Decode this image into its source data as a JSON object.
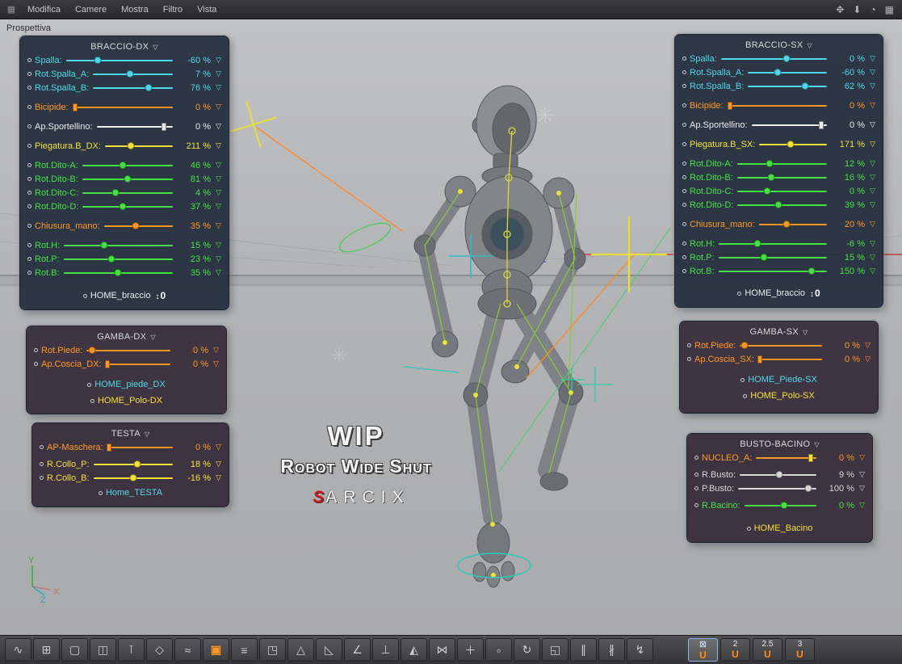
{
  "colors": {
    "cyan": "#4fd8ea",
    "orange": "#ff9822",
    "yellow": "#f2e03c",
    "green": "#46e046",
    "white": "#ececec",
    "gray": "#d8d8d8"
  },
  "menubar": {
    "items": [
      "Modifica",
      "Camere",
      "Mostra",
      "Filtro",
      "Vista"
    ],
    "right_icons": [
      {
        "name": "pan-icon",
        "glyph": "✥"
      },
      {
        "name": "down-arrow-icon",
        "glyph": "⬇"
      },
      {
        "name": "clock-icon",
        "glyph": "◔"
      },
      {
        "name": "grid-icon",
        "glyph": "▦"
      }
    ]
  },
  "viewport": {
    "view_label": "Prospettiva",
    "watermark_line1": "WIP",
    "watermark_line2": "Robot Wide Shut",
    "logo_s": "S",
    "logo_text": "ARCIX",
    "axis_x": "X",
    "axis_y": "Y",
    "axis_z": "Z"
  },
  "panels": [
    {
      "id": "braccio-dx",
      "title": "BRACCIO-DX",
      "theme": "blue",
      "rows": [
        {
          "type": "slider",
          "label": "Spalla:",
          "value": "-60 %",
          "color": "cyan",
          "pos": 0.3
        },
        {
          "type": "slider",
          "label": "Rot.Spalla_A:",
          "value": "7 %",
          "color": "cyan",
          "pos": 0.46
        },
        {
          "type": "slider",
          "label": "Rot.Spalla_B:",
          "value": "76 %",
          "color": "cyan",
          "pos": 0.7
        },
        {
          "type": "gap"
        },
        {
          "type": "slider",
          "label": "Bicipide:",
          "value": "0 %",
          "color": "orange",
          "pos": 0.03,
          "shape": "square"
        },
        {
          "type": "gap"
        },
        {
          "type": "slider",
          "label": "Ap.Sportellino:",
          "value": "0 %",
          "color": "white",
          "pos": 0.88,
          "shape": "square"
        },
        {
          "type": "gap"
        },
        {
          "type": "slider",
          "label": "Piegatura.B_DX:",
          "value": "211 %",
          "color": "yellow",
          "pos": 0.38
        },
        {
          "type": "gap"
        },
        {
          "type": "slider",
          "label": "Rot.Dito-A:",
          "value": "46 %",
          "color": "green",
          "pos": 0.45
        },
        {
          "type": "slider",
          "label": "Rot.Dito-B:",
          "value": "81 %",
          "color": "green",
          "pos": 0.5
        },
        {
          "type": "slider",
          "label": "Rot.Dito-C:",
          "value": "4 %",
          "color": "green",
          "pos": 0.36
        },
        {
          "type": "slider",
          "label": "Rot.Dito-D:",
          "value": "37 %",
          "color": "green",
          "pos": 0.44
        },
        {
          "type": "gap"
        },
        {
          "type": "slider",
          "label": "Chiusura_mano:",
          "value": "35 %",
          "color": "orange",
          "pos": 0.46
        },
        {
          "type": "gap"
        },
        {
          "type": "slider",
          "label": "Rot.H:",
          "value": "15 %",
          "color": "green",
          "pos": 0.37
        },
        {
          "type": "slider",
          "label": "Rot.P:",
          "value": "23 %",
          "color": "green",
          "pos": 0.44
        },
        {
          "type": "slider",
          "label": "Rot.B:",
          "value": "35 %",
          "color": "green",
          "pos": 0.5
        },
        {
          "type": "home",
          "label": "HOME_braccio",
          "color": "white",
          "icon": "reset-zero"
        }
      ]
    },
    {
      "id": "braccio-sx",
      "title": "BRACCIO-SX",
      "theme": "blue",
      "rows": [
        {
          "type": "slider",
          "label": "Spalla:",
          "value": "0 %",
          "color": "cyan",
          "pos": 0.62
        },
        {
          "type": "slider",
          "label": "Rot.Spalla_A:",
          "value": "-60 %",
          "color": "cyan",
          "pos": 0.38
        },
        {
          "type": "slider",
          "label": "Rot.Spalla_B:",
          "value": "62 %",
          "color": "cyan",
          "pos": 0.72
        },
        {
          "type": "gap"
        },
        {
          "type": "slider",
          "label": "Bicipide:",
          "value": "0 %",
          "color": "orange",
          "pos": 0.03,
          "shape": "square"
        },
        {
          "type": "gap"
        },
        {
          "type": "slider",
          "label": "Ap.Sportellino:",
          "value": "0 %",
          "color": "white",
          "pos": 0.93,
          "shape": "square"
        },
        {
          "type": "gap"
        },
        {
          "type": "slider",
          "label": "Piegatura.B_SX:",
          "value": "171 %",
          "color": "yellow",
          "pos": 0.46
        },
        {
          "type": "gap"
        },
        {
          "type": "slider",
          "label": "Rot.Dito-A:",
          "value": "12 %",
          "color": "green",
          "pos": 0.36
        },
        {
          "type": "slider",
          "label": "Rot.Dito-B:",
          "value": "16 %",
          "color": "green",
          "pos": 0.38
        },
        {
          "type": "slider",
          "label": "Rot.Dito-C:",
          "value": "0 %",
          "color": "green",
          "pos": 0.33
        },
        {
          "type": "slider",
          "label": "Rot.Dito-D:",
          "value": "39 %",
          "color": "green",
          "pos": 0.46
        },
        {
          "type": "gap"
        },
        {
          "type": "slider",
          "label": "Chiusura_mano:",
          "value": "20 %",
          "color": "orange",
          "pos": 0.41
        },
        {
          "type": "gap"
        },
        {
          "type": "slider",
          "label": "Rot.H:",
          "value": "-6 %",
          "color": "green",
          "pos": 0.36
        },
        {
          "type": "slider",
          "label": "Rot.P:",
          "value": "15 %",
          "color": "green",
          "pos": 0.42
        },
        {
          "type": "slider",
          "label": "Rot.B:",
          "value": "150 %",
          "color": "green",
          "pos": 0.86
        },
        {
          "type": "home",
          "label": "HOME_braccio",
          "color": "white",
          "icon": "reset-zero"
        }
      ]
    },
    {
      "id": "gamba-dx",
      "title": "GAMBA-DX",
      "theme": "purple",
      "rows": [
        {
          "type": "slider",
          "label": "Rot.Piede:",
          "value": "0 %",
          "color": "orange",
          "pos": 0.06
        },
        {
          "type": "slider",
          "label": "Ap.Coscia_DX:",
          "value": "0 %",
          "color": "orange",
          "pos": 0.03,
          "shape": "square"
        },
        {
          "type": "gap"
        },
        {
          "type": "button",
          "label": "HOME_piede_DX",
          "color": "cyan"
        },
        {
          "type": "button",
          "label": "HOME_Polo-DX",
          "color": "yellow"
        }
      ]
    },
    {
      "id": "gamba-sx",
      "title": "GAMBA-SX",
      "theme": "purple",
      "rows": [
        {
          "type": "slider",
          "label": "Rot.Piede:",
          "value": "0 %",
          "color": "orange",
          "pos": 0.06
        },
        {
          "type": "slider",
          "label": "Ap.Coscia_SX:",
          "value": "0 %",
          "color": "orange",
          "pos": 0.03,
          "shape": "square"
        },
        {
          "type": "gap"
        },
        {
          "type": "button",
          "label": "HOME_Piede-SX",
          "color": "cyan"
        },
        {
          "type": "button",
          "label": "HOME_Polo-SX",
          "color": "yellow"
        }
      ]
    },
    {
      "id": "testa",
      "title": "TESTA",
      "theme": "purple",
      "rows": [
        {
          "type": "slider",
          "label": "AP-Maschera:",
          "value": "0 %",
          "color": "orange",
          "pos": 0.03,
          "shape": "square"
        },
        {
          "type": "gap",
          "small": true
        },
        {
          "type": "slider",
          "label": "R.Collo_P:",
          "value": "18 %",
          "color": "yellow",
          "pos": 0.55
        },
        {
          "type": "slider",
          "label": "R.Collo_B:",
          "value": "-16 %",
          "color": "yellow",
          "pos": 0.5
        },
        {
          "type": "button",
          "label": "Home_TESTA",
          "color": "cyan"
        }
      ]
    },
    {
      "id": "busto-bacino",
      "title": "BUSTO-BACINO",
      "theme": "purple",
      "rows": [
        {
          "type": "slider",
          "label": "NUCLEO_A:",
          "value": "0 %",
          "color": "orange",
          "pos": 0.9,
          "shape": "square",
          "handle_color": "yellow"
        },
        {
          "type": "gap",
          "small": true
        },
        {
          "type": "slider",
          "label": "R.Busto:",
          "value": "9 %",
          "color": "gray",
          "pos": 0.52
        },
        {
          "type": "slider",
          "label": "P.Busto:",
          "value": "100 %",
          "color": "gray",
          "pos": 0.9
        },
        {
          "type": "gap",
          "small": true
        },
        {
          "type": "slider",
          "label": "R.Bacino:",
          "value": "0 %",
          "color": "green",
          "pos": 0.55
        },
        {
          "type": "home",
          "label": "HOME_Bacino",
          "color": "yellow"
        }
      ]
    }
  ],
  "toolbar": {
    "buttons": [
      {
        "name": "spline-tool",
        "glyph": "∿"
      },
      {
        "name": "magnet-grid-tool",
        "glyph": "⊞"
      },
      {
        "name": "box-tool",
        "glyph": "▢"
      },
      {
        "name": "grid-tool",
        "glyph": "◫"
      },
      {
        "name": "pole-tool",
        "glyph": "⊺"
      },
      {
        "name": "plane-tool",
        "glyph": "◇"
      },
      {
        "name": "wave-tool",
        "glyph": "≈"
      },
      {
        "name": "add-box-tool",
        "glyph": "▣",
        "accent": true
      },
      {
        "name": "rake-tool",
        "glyph": "≡"
      },
      {
        "name": "cube-tool",
        "glyph": "◳"
      },
      {
        "name": "cone-tool",
        "glyph": "△"
      },
      {
        "name": "ramp-tool",
        "glyph": "◺"
      },
      {
        "name": "angle-tool",
        "glyph": "∠"
      },
      {
        "name": "drop-tool",
        "glyph": "⊥"
      },
      {
        "name": "pyramid-tool",
        "glyph": "◭"
      },
      {
        "name": "bowtie-tool",
        "glyph": "⋈"
      },
      {
        "name": "move-tool",
        "glyph": "＋"
      },
      {
        "name": "frame-tool",
        "glyph": "▫"
      },
      {
        "name": "rotate-tool",
        "glyph": "↻"
      },
      {
        "name": "shear-tool",
        "glyph": "◱"
      },
      {
        "name": "array-tool",
        "glyph": "∥"
      },
      {
        "name": "mirror-tool",
        "glyph": "∦"
      },
      {
        "name": "bend-tool",
        "glyph": "↯"
      }
    ],
    "right_buttons": [
      {
        "name": "viewport-single-button",
        "top": "⊠",
        "sub": "U",
        "selected": true
      },
      {
        "name": "viewport-2-button",
        "top": "2",
        "sub": "U"
      },
      {
        "name": "viewport-2-5-button",
        "top": "2.5",
        "sub": "U"
      },
      {
        "name": "viewport-3-button",
        "top": "3",
        "sub": "U"
      }
    ]
  }
}
